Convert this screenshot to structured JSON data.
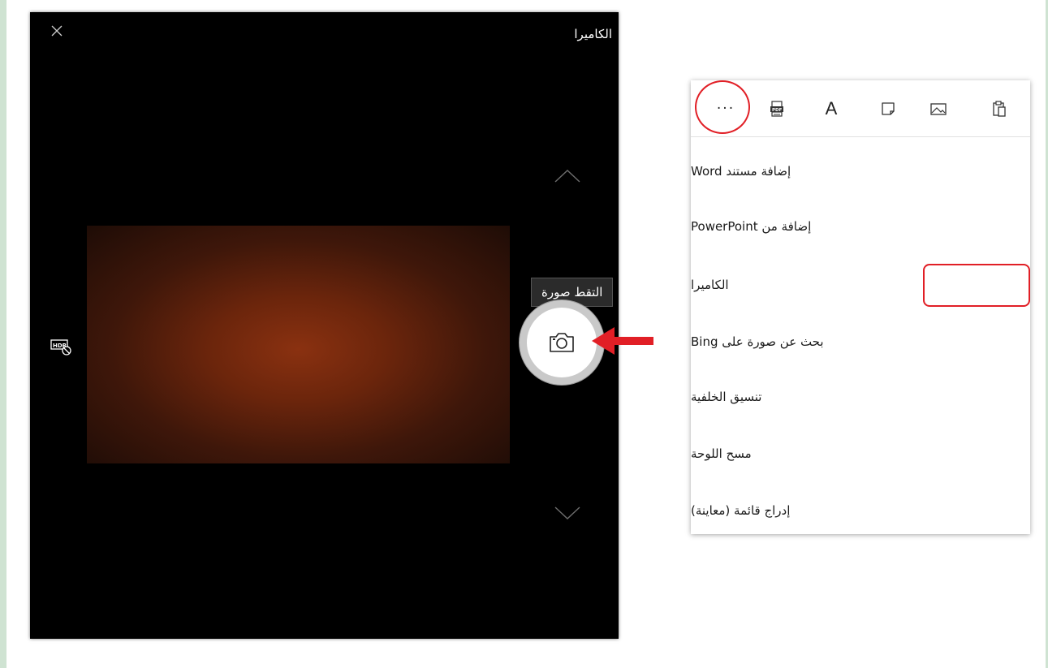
{
  "camera": {
    "title": "الكاميرا",
    "tooltip": "التقط صورة",
    "icons": {
      "close": "close-icon",
      "up": "chevron-up-icon",
      "down": "chevron-down-icon",
      "hdr": "hdr-off-icon",
      "shutter": "camera-icon"
    }
  },
  "menu": {
    "toolbar": {
      "more_label": "···",
      "font_label": "A",
      "icons": [
        "more-icon",
        "pdf-icon",
        "text-icon",
        "sticky-note-icon",
        "image-icon",
        "paste-icon"
      ]
    },
    "items": [
      {
        "label": "إضافة مستند Word"
      },
      {
        "label": "إضافة من PowerPoint"
      },
      {
        "label": "الكاميرا"
      },
      {
        "label": "بحث عن صورة على Bing"
      },
      {
        "label": "تنسيق الخلفية"
      },
      {
        "label": "مسح اللوحة"
      },
      {
        "label": "إدراج قائمة (معاينة)"
      }
    ]
  },
  "colors": {
    "annotation_red": "#e11f26",
    "camera_bg": "#000000",
    "preview_center": "#8a3110"
  }
}
